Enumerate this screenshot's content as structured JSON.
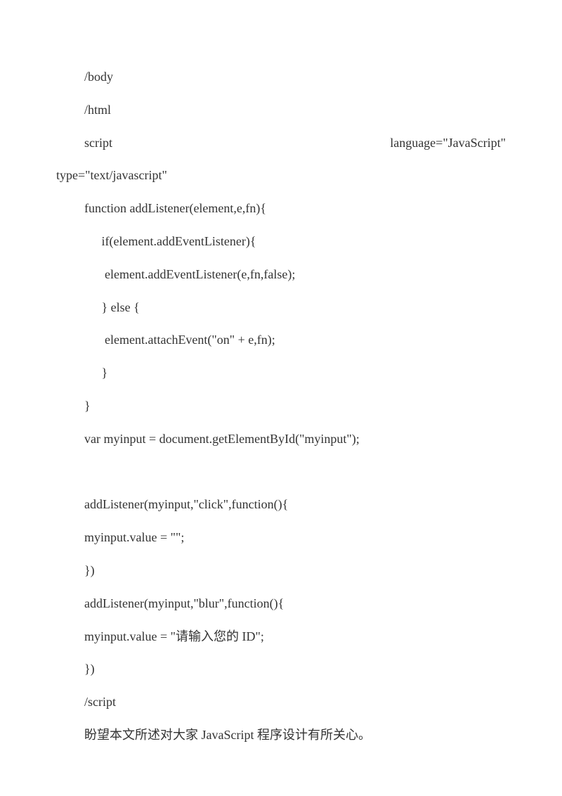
{
  "lines": {
    "l1": "/body",
    "l2": "/html",
    "l3_left": "script",
    "l3_right": "language=\"JavaScript\"",
    "l4": "type=\"text/javascript\"",
    "l5": "function addListener(element,e,fn){",
    "l6": " if(element.addEventListener){",
    "l7": "  element.addEventListener(e,fn,false);",
    "l8": " } else {",
    "l9": "  element.attachEvent(\"on\" + e,fn);",
    "l10": " }",
    "l11": "}",
    "l12": "var myinput = document.getElementById(\"myinput\");",
    "l13": "",
    "l14": "addListener(myinput,\"click\",function(){",
    "l15": "myinput.value = \"\";",
    "l16": "})",
    "l17": "addListener(myinput,\"blur\",function(){",
    "l18": "myinput.value = \"请输入您的 ID\";",
    "l19": "})",
    "l20": "/script",
    "l21": "盼望本文所述对大家 JavaScript 程序设计有所关心。"
  }
}
